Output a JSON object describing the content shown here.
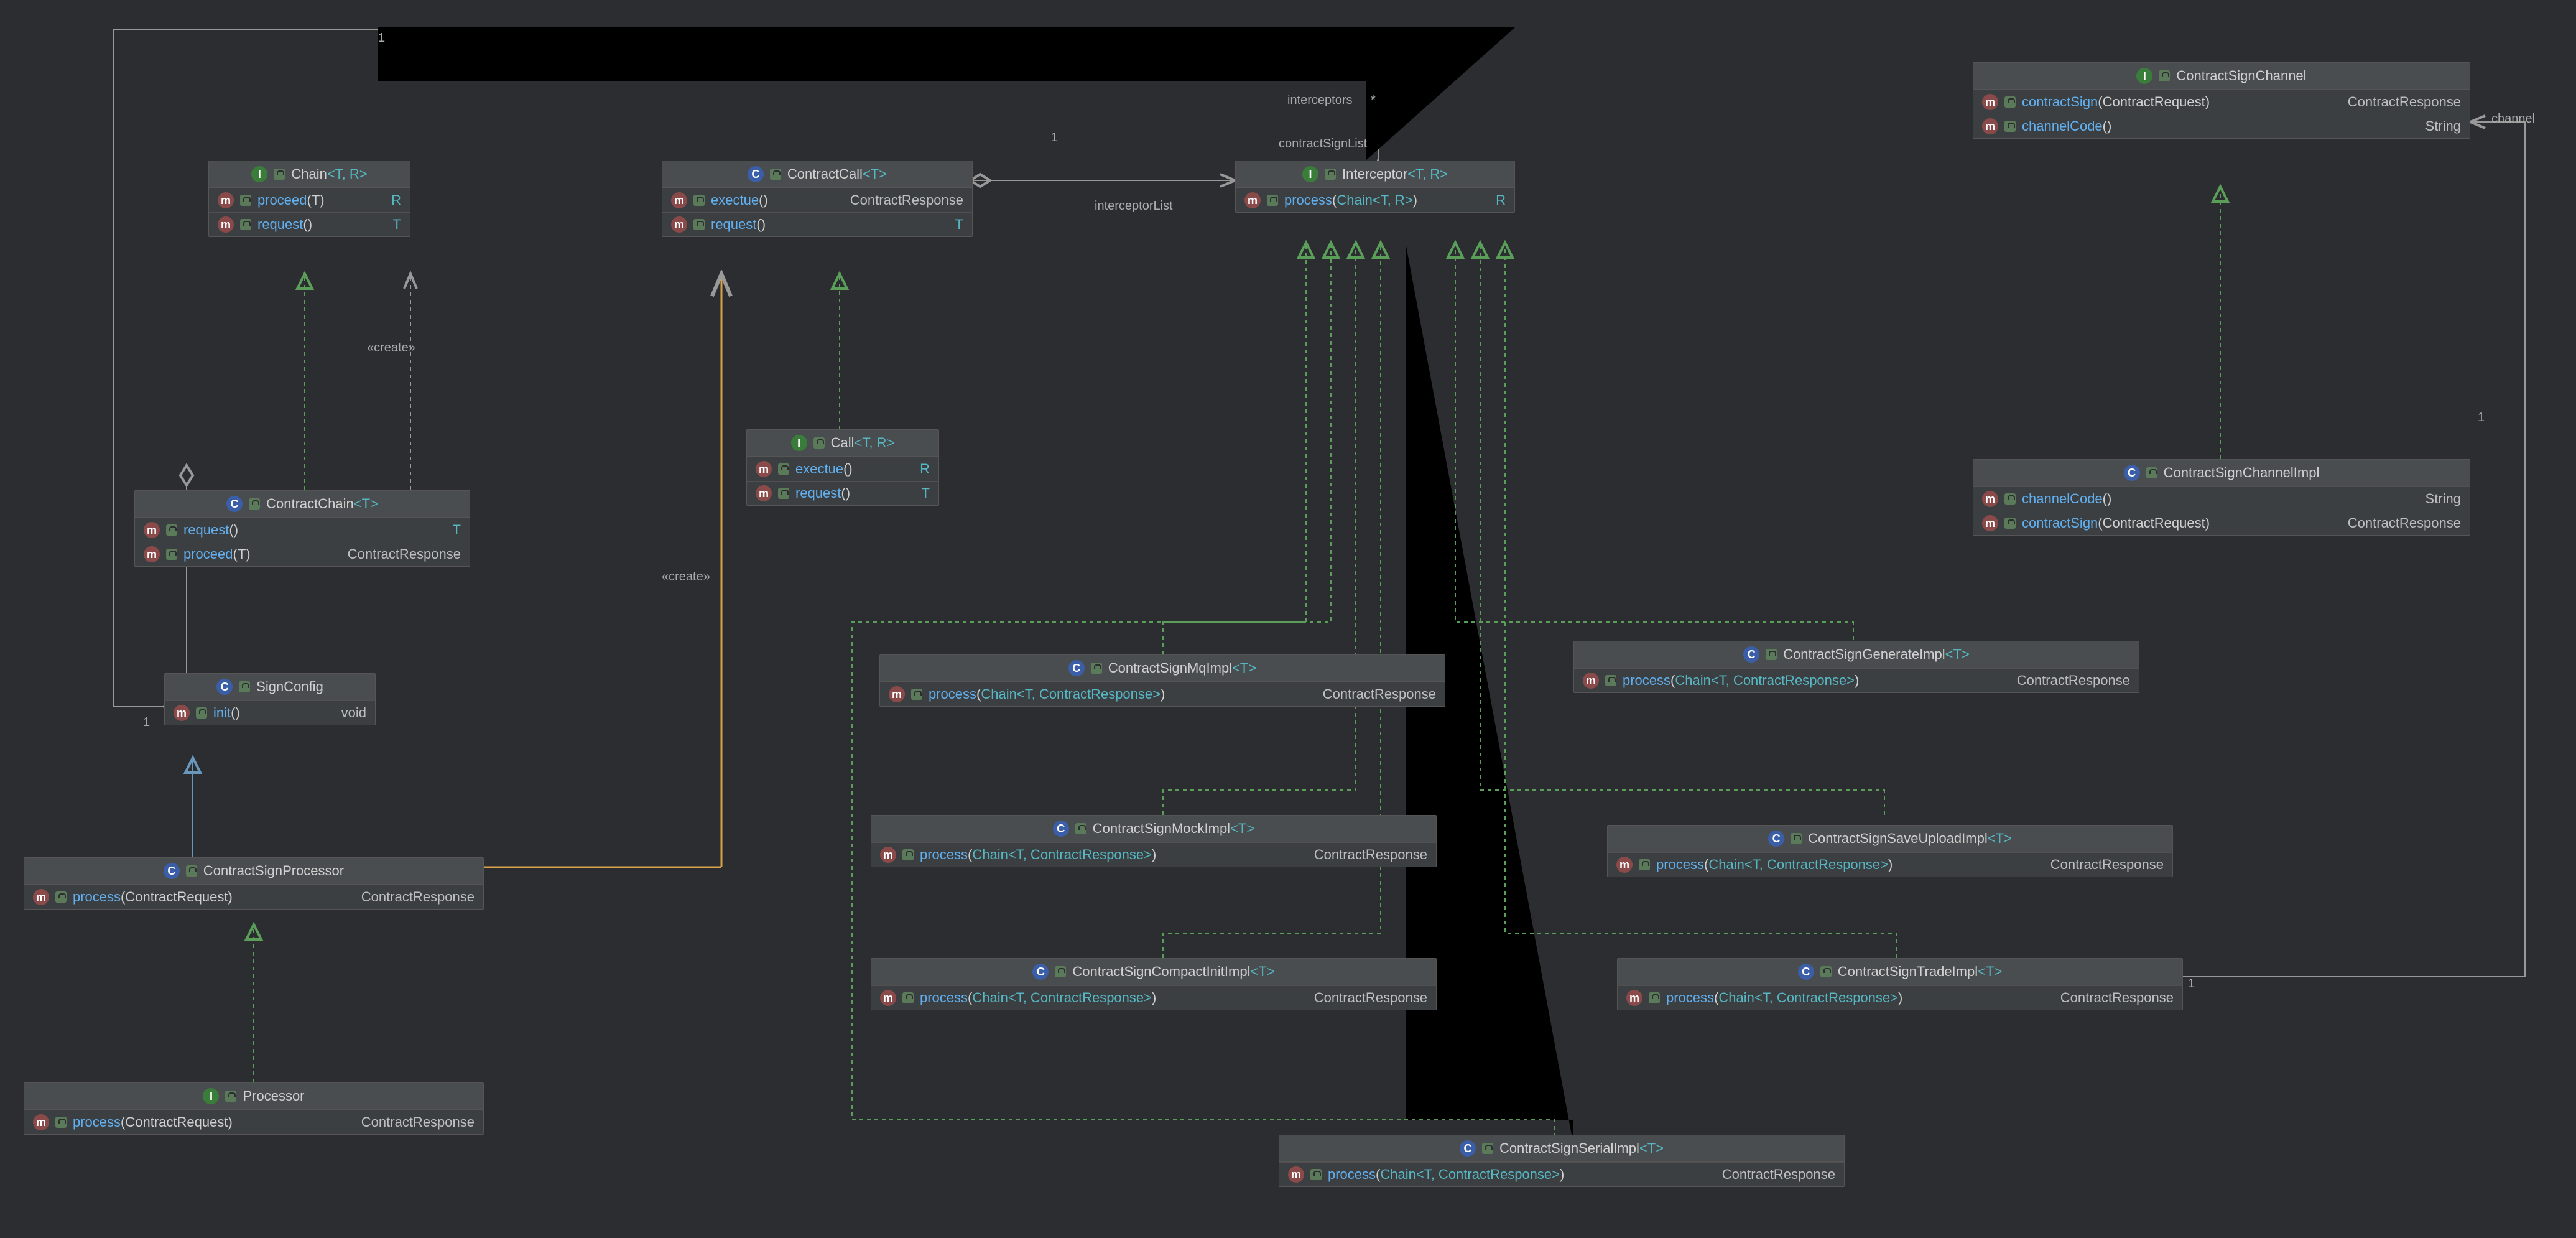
{
  "labels": {
    "interceptors": "interceptors",
    "interceptors_mult": "*",
    "contractSignList": "contractSignList",
    "one_top": "1",
    "one_mid": "1",
    "interceptorList": "interceptorList",
    "create1": "«create»",
    "create2": "«create»",
    "one_signconfig": "1",
    "one_trade": "1",
    "one_channelimpl": "1",
    "channel": "channel"
  },
  "boxes": {
    "chain": {
      "title": "Chain",
      "generic": "<T, R>",
      "methods": [
        {
          "name": "proceed",
          "params": "(T)",
          "ret": "R",
          "retSingle": true
        },
        {
          "name": "request",
          "params": "()",
          "ret": "T",
          "retSingle": true
        }
      ]
    },
    "contractCall": {
      "title": "ContractCall",
      "generic": "<T>",
      "methods": [
        {
          "name": "exectue",
          "params": "()",
          "ret": "ContractResponse"
        },
        {
          "name": "request",
          "params": "()",
          "ret": "T",
          "retSingle": true
        }
      ]
    },
    "interceptor": {
      "title": "Interceptor",
      "generic": "<T, R>",
      "methods": [
        {
          "name": "process",
          "params_open": "(",
          "param_type": "Chain",
          "param_generic": "<T, R>",
          "params_close": ")",
          "ret": "R",
          "retSingle": true
        }
      ]
    },
    "contractSignChannel": {
      "title": "ContractSignChannel",
      "methods": [
        {
          "name": "contractSign",
          "params": "(ContractRequest)",
          "ret": "ContractResponse"
        },
        {
          "name": "channelCode",
          "params": "()",
          "ret": "String"
        }
      ]
    },
    "call": {
      "title": "Call",
      "generic": "<T, R>",
      "methods": [
        {
          "name": "exectue",
          "params": "()",
          "ret": "R",
          "retSingle": true
        },
        {
          "name": "request",
          "params": "()",
          "ret": "T",
          "retSingle": true
        }
      ]
    },
    "contractChain": {
      "title": "ContractChain",
      "generic": "<T>",
      "methods": [
        {
          "name": "request",
          "params": "()",
          "ret": "T",
          "retSingle": true
        },
        {
          "name": "proceed",
          "params": "(T)",
          "ret": "ContractResponse"
        }
      ]
    },
    "contractSignChannelImpl": {
      "title": "ContractSignChannelImpl",
      "methods": [
        {
          "name": "channelCode",
          "params": "()",
          "ret": "String"
        },
        {
          "name": "contractSign",
          "params": "(ContractRequest)",
          "ret": "ContractResponse"
        }
      ]
    },
    "signConfig": {
      "title": "SignConfig",
      "methods": [
        {
          "name": "init",
          "params": "()",
          "ret": "void"
        }
      ]
    },
    "contractSignMqImpl": {
      "title": "ContractSignMqImpl",
      "generic": "<T>",
      "methods": [
        {
          "name": "process",
          "params_open": "(",
          "param_type": "Chain",
          "param_generic": "<T, ContractResponse>",
          "params_close": ")",
          "ret": "ContractResponse"
        }
      ]
    },
    "contractSignGenerateImpl": {
      "title": "ContractSignGenerateImpl",
      "generic": "<T>",
      "methods": [
        {
          "name": "process",
          "params_open": "(",
          "param_type": "Chain",
          "param_generic": "<T, ContractResponse>",
          "params_close": ")",
          "ret": "ContractResponse"
        }
      ]
    },
    "contractSignMockImpl": {
      "title": "ContractSignMockImpl",
      "generic": "<T>",
      "methods": [
        {
          "name": "process",
          "params_open": "(",
          "param_type": "Chain",
          "param_generic": "<T, ContractResponse>",
          "params_close": ")",
          "ret": "ContractResponse"
        }
      ]
    },
    "contractSignSaveUploadImpl": {
      "title": "ContractSignSaveUploadImpl",
      "generic": "<T>",
      "methods": [
        {
          "name": "process",
          "params_open": "(",
          "param_type": "Chain",
          "param_generic": "<T, ContractResponse>",
          "params_close": ")",
          "ret": "ContractResponse"
        }
      ]
    },
    "contractSignProcessor": {
      "title": "ContractSignProcessor",
      "methods": [
        {
          "name": "process",
          "params": "(ContractRequest)",
          "ret": "ContractResponse"
        }
      ]
    },
    "contractSignCompactInitImpl": {
      "title": "ContractSignCompactInitImpl",
      "generic": "<T>",
      "methods": [
        {
          "name": "process",
          "params_open": "(",
          "param_type": "Chain",
          "param_generic": "<T, ContractResponse>",
          "params_close": ")",
          "ret": "ContractResponse"
        }
      ]
    },
    "contractSignTradeImpl": {
      "title": "ContractSignTradeImpl",
      "generic": "<T>",
      "methods": [
        {
          "name": "process",
          "params_open": "(",
          "param_type": "Chain",
          "param_generic": "<T, ContractResponse>",
          "params_close": ")",
          "ret": "ContractResponse"
        }
      ]
    },
    "processor": {
      "title": "Processor",
      "methods": [
        {
          "name": "process",
          "params": "(ContractRequest)",
          "ret": "ContractResponse"
        }
      ]
    },
    "contractSignSerialImpl": {
      "title": "ContractSignSerialImpl",
      "generic": "<T>",
      "methods": [
        {
          "name": "process",
          "params_open": "(",
          "param_type": "Chain",
          "param_generic": "<T, ContractResponse>",
          "params_close": ")",
          "ret": "ContractResponse"
        }
      ]
    }
  }
}
